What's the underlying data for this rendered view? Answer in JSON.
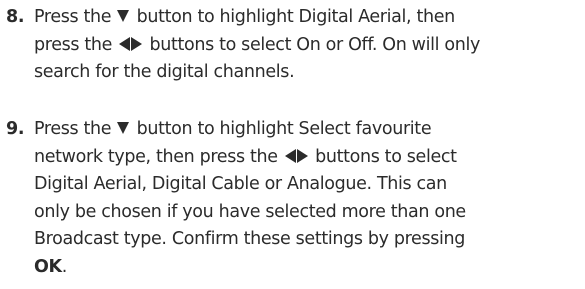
{
  "steps": [
    {
      "number": "8.",
      "lines": {
        "l1_a": "Press the",
        "l1_b": "button to highlight Digital Aerial, then",
        "l2_a": "press the",
        "l2_b": "buttons to select On or Off. On will only",
        "l3": "search for the digital channels."
      }
    },
    {
      "number": "9.",
      "lines": {
        "l1_a": "Press the",
        "l1_b": "button to highlight Select favourite",
        "l2_a": "network type, then press the",
        "l2_b": "buttons to select",
        "l3": "Digital Aerial, Digital Cable or Analogue. This can",
        "l4": "only be chosen if you have selected more than one",
        "l5": "Broadcast type. Confirm these settings by pressing",
        "l6_bold": "OK",
        "l6_tail": "."
      }
    }
  ],
  "icons": {
    "down": "down-triangle-icon",
    "left": "left-triangle-icon",
    "right": "right-triangle-icon"
  }
}
